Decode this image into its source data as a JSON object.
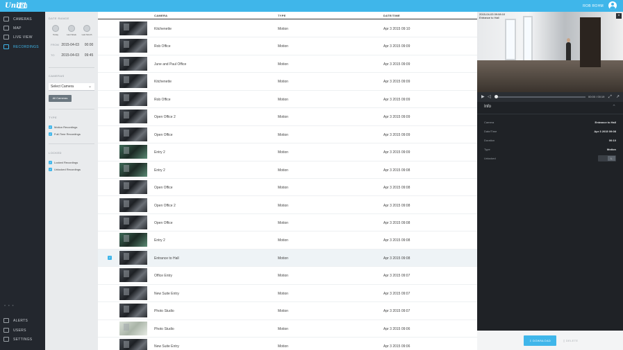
{
  "header": {
    "logo_text": "UniFi",
    "logo_badge": "video",
    "user_name": "ROB ROHM"
  },
  "sidebar": {
    "items": [
      {
        "label": "CAMERAS",
        "icon": "camera-icon"
      },
      {
        "label": "MAP",
        "icon": "map-icon"
      },
      {
        "label": "LIVE VIEW",
        "icon": "live-view-icon"
      },
      {
        "label": "RECORDINGS",
        "icon": "recordings-icon"
      }
    ],
    "bottom_items": [
      {
        "label": "ALERTS",
        "icon": "bell-icon"
      },
      {
        "label": "USERS",
        "icon": "users-icon"
      },
      {
        "label": "SETTINGS",
        "icon": "gear-icon"
      }
    ],
    "dots": "• • •"
  },
  "filters": {
    "date_range_heading": "DATE RANGE",
    "range_buttons": [
      "Today",
      "Last Week",
      "Last Month"
    ],
    "from_date": "2015-04-03",
    "from_time": "00:00",
    "to_date": "2015-04-03",
    "to_time": "09:45",
    "from_label": "FROM",
    "to_label": "TO",
    "cameras_heading": "CAMERAS",
    "select_camera": "Select Camera",
    "all_cameras_button": "All Cameras",
    "type_heading": "TYPE",
    "type_options": [
      "Motion Recordings",
      "Full-Time Recordings"
    ],
    "locked_heading": "LOCKED",
    "locked_options": [
      "Locked Recordings",
      "Unlocked Recordings"
    ]
  },
  "list": {
    "columns": {
      "camera": "CAMERA",
      "type": "TYPE",
      "datetime": "DATE/TIME"
    },
    "rows": [
      {
        "camera": "Kitchenette",
        "type": "Motion",
        "datetime": "Apr 3 2015 09:10",
        "thumb": "dark"
      },
      {
        "camera": "Rob Office",
        "type": "Motion",
        "datetime": "Apr 3 2015 09:09",
        "thumb": "dark"
      },
      {
        "camera": "June and Paul Office",
        "type": "Motion",
        "datetime": "Apr 3 2015 09:09",
        "thumb": "dark"
      },
      {
        "camera": "Kitchenette",
        "type": "Motion",
        "datetime": "Apr 3 2015 09:09",
        "thumb": "dark"
      },
      {
        "camera": "Rob Office",
        "type": "Motion",
        "datetime": "Apr 3 2015 09:09",
        "thumb": "dark"
      },
      {
        "camera": "Open Office 2",
        "type": "Motion",
        "datetime": "Apr 3 2015 09:09",
        "thumb": "dark"
      },
      {
        "camera": "Open Office",
        "type": "Motion",
        "datetime": "Apr 3 2015 09:09",
        "thumb": "dark"
      },
      {
        "camera": "Entry 2",
        "type": "Motion",
        "datetime": "Apr 3 2015 09:09",
        "thumb": "green"
      },
      {
        "camera": "Entry 2",
        "type": "Motion",
        "datetime": "Apr 3 2015 09:08",
        "thumb": "green"
      },
      {
        "camera": "Open Office",
        "type": "Motion",
        "datetime": "Apr 3 2015 09:08",
        "thumb": "dark"
      },
      {
        "camera": "Open Office 2",
        "type": "Motion",
        "datetime": "Apr 3 2015 09:08",
        "thumb": "dark"
      },
      {
        "camera": "Open Office",
        "type": "Motion",
        "datetime": "Apr 3 2015 09:08",
        "thumb": "dark"
      },
      {
        "camera": "Entry 2",
        "type": "Motion",
        "datetime": "Apr 3 2015 09:08",
        "thumb": "green"
      },
      {
        "camera": "Entrance to Hall",
        "type": "Motion",
        "datetime": "Apr 3 2015 09:08",
        "thumb": "dark",
        "selected": true
      },
      {
        "camera": "Office Entry",
        "type": "Motion",
        "datetime": "Apr 3 2015 09:07",
        "thumb": "dark"
      },
      {
        "camera": "New Suite Entry",
        "type": "Motion",
        "datetime": "Apr 3 2015 09:07",
        "thumb": "dark"
      },
      {
        "camera": "Photo Studio",
        "type": "Motion",
        "datetime": "Apr 3 2015 09:07",
        "thumb": "dark"
      },
      {
        "camera": "Photo Studio",
        "type": "Motion",
        "datetime": "Apr 3 2015 09:06",
        "thumb": "light"
      },
      {
        "camera": "New Suite Entry",
        "type": "Motion",
        "datetime": "Apr 3 2015 09:06",
        "thumb": "dark"
      }
    ]
  },
  "player": {
    "timestamp": "2015-04-03 09:08:10",
    "camera_overlay": "Entrance to Hall",
    "time_readout": "00:00 / 00:19"
  },
  "info": {
    "title": "Info",
    "fields": [
      {
        "key": "Camera",
        "value": "Entrance to Hall"
      },
      {
        "key": "Date/Time",
        "value": "Apr 3 2015 09:08"
      },
      {
        "key": "Duration",
        "value": "00:10"
      },
      {
        "key": "Type",
        "value": "Motion"
      },
      {
        "key": "Unlocked",
        "value": ""
      }
    ],
    "lock_toggle": "L"
  },
  "actions": {
    "download": "DOWNLOAD",
    "delete": "DELETE"
  },
  "colors": {
    "accent": "#3fb6ea",
    "sidebar_bg": "#23272e",
    "panel_bg": "#1f2226"
  }
}
